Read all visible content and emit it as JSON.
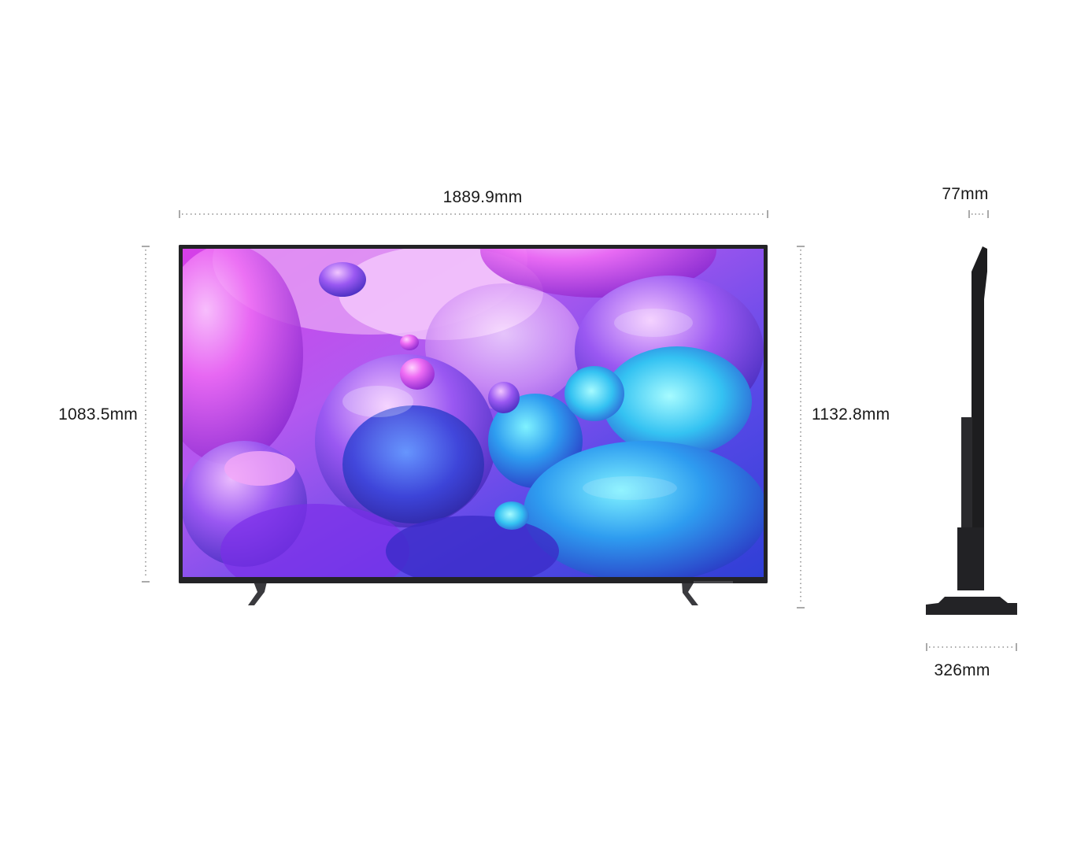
{
  "dimensions": {
    "width": "1889.9mm",
    "height_without_stand": "1083.5mm",
    "height_with_stand": "1132.8mm",
    "depth": "77mm",
    "stand_depth": "326mm"
  },
  "colors": {
    "bezel": "#232326",
    "stand": "#3a3a3e",
    "dim_line": "#555555",
    "label": "#1a1a1a"
  }
}
